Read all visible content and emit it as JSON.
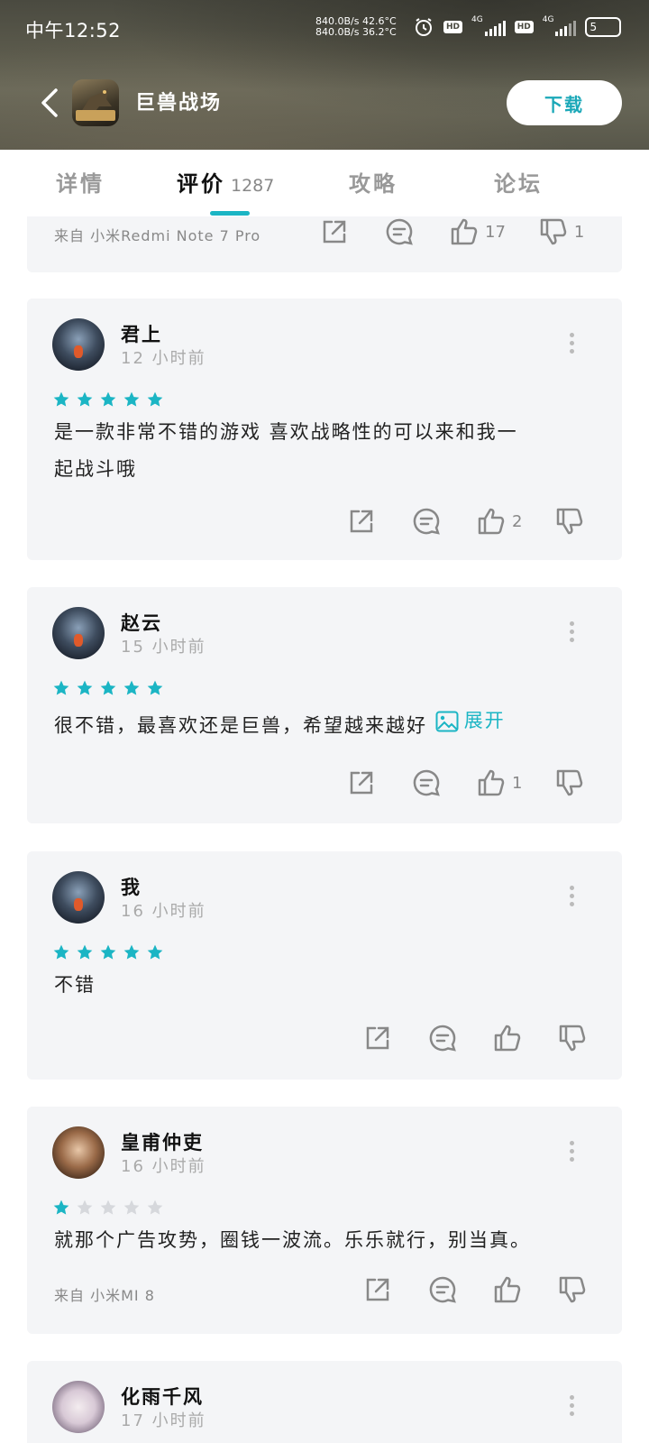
{
  "status": {
    "time": "中午12:52",
    "net_line1": "840.0B/s 42.6°C",
    "net_line2": "840.0B/s 36.2°C",
    "hd1": "HD",
    "net1": "4G",
    "hd2": "HD",
    "net2": "4G",
    "battery": "5"
  },
  "app": {
    "title": "巨兽战场",
    "download_label": "下载",
    "icon_banner": "猎龙求员"
  },
  "tabs": [
    {
      "label": "详情"
    },
    {
      "label": "评价",
      "count": "1287"
    },
    {
      "label": "攻略"
    },
    {
      "label": "论坛"
    }
  ],
  "partial_review": {
    "device": "来自 小米Redmi Note 7 Pro",
    "likes": "17",
    "dislikes": "1"
  },
  "reviews": [
    {
      "name": "君上",
      "time": "12 小时前",
      "rating": 5,
      "text_line1": "是一款非常不错的游戏 喜欢战略性的可以来和我一",
      "text_line2": "起战斗哦",
      "likes": "2"
    },
    {
      "name": "赵云",
      "time": "15 小时前",
      "rating": 5,
      "text_line1": "很不错，最喜欢还是巨兽，希望越来越好",
      "expand_label": "展开",
      "likes": "1"
    },
    {
      "name": "我",
      "time": "16 小时前",
      "rating": 5,
      "text_line1": "不错"
    },
    {
      "name": "皇甫仲吏",
      "time": "16 小时前",
      "rating": 1,
      "text_line1": "就那个广告攻势，圈钱一波流。乐乐就行，别当真。",
      "device": "来自 小米MI 8"
    },
    {
      "name": "化雨千风",
      "time": "17 小时前"
    }
  ],
  "colors": {
    "accent": "#1bb5c4",
    "star_on": "#1bb5c4",
    "star_off": "#d6d8dc",
    "card_bg": "#f4f5f7"
  }
}
